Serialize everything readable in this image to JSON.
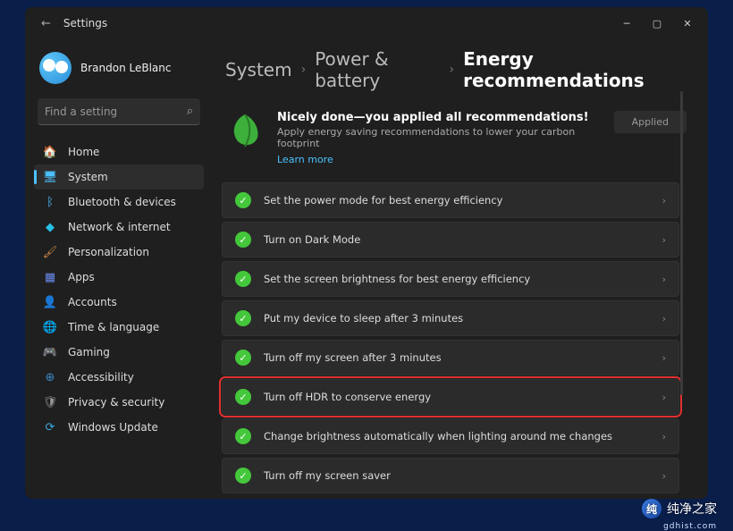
{
  "titlebar": {
    "title": "Settings"
  },
  "user": {
    "name": "Brandon LeBlanc"
  },
  "search": {
    "placeholder": "Find a setting"
  },
  "sidebar": {
    "items": [
      {
        "icon": "🏠",
        "label": "Home",
        "color": "#bbb"
      },
      {
        "icon": "🖥",
        "label": "System",
        "color": "#4cc2ff",
        "active": true
      },
      {
        "icon": "ᛒ",
        "label": "Bluetooth & devices",
        "color": "#4cc2ff"
      },
      {
        "icon": "◆",
        "label": "Network & internet",
        "color": "#29c0e8"
      },
      {
        "icon": "🖌",
        "label": "Personalization",
        "color": "#d08a4a"
      },
      {
        "icon": "▦",
        "label": "Apps",
        "color": "#6a8af0"
      },
      {
        "icon": "👤",
        "label": "Accounts",
        "color": "#bbb"
      },
      {
        "icon": "🌐",
        "label": "Time & language",
        "color": "#3aa8e0"
      },
      {
        "icon": "🎮",
        "label": "Gaming",
        "color": "#999"
      },
      {
        "icon": "⊕",
        "label": "Accessibility",
        "color": "#3a8ac8"
      },
      {
        "icon": "🛡",
        "label": "Privacy & security",
        "color": "#999"
      },
      {
        "icon": "⟳",
        "label": "Windows Update",
        "color": "#3aa8e0"
      }
    ]
  },
  "breadcrumb": {
    "root": "System",
    "mid": "Power & battery",
    "leaf": "Energy recommendations"
  },
  "hero": {
    "title": "Nicely done—you applied all recommendations!",
    "subtitle": "Apply energy saving recommendations to lower your carbon footprint",
    "link": "Learn more",
    "button": "Applied"
  },
  "recommendations": [
    {
      "label": "Set the power mode for best energy efficiency"
    },
    {
      "label": "Turn on Dark Mode"
    },
    {
      "label": "Set the screen brightness for best energy efficiency"
    },
    {
      "label": "Put my device to sleep after 3 minutes"
    },
    {
      "label": "Turn off my screen after 3 minutes"
    },
    {
      "label": "Turn off HDR to conserve energy",
      "highlighted": true
    },
    {
      "label": "Change brightness automatically when lighting around me changes"
    },
    {
      "label": "Turn off my screen saver"
    }
  ],
  "watermark": {
    "text": "纯净之家",
    "sub": "gdhist.com"
  }
}
